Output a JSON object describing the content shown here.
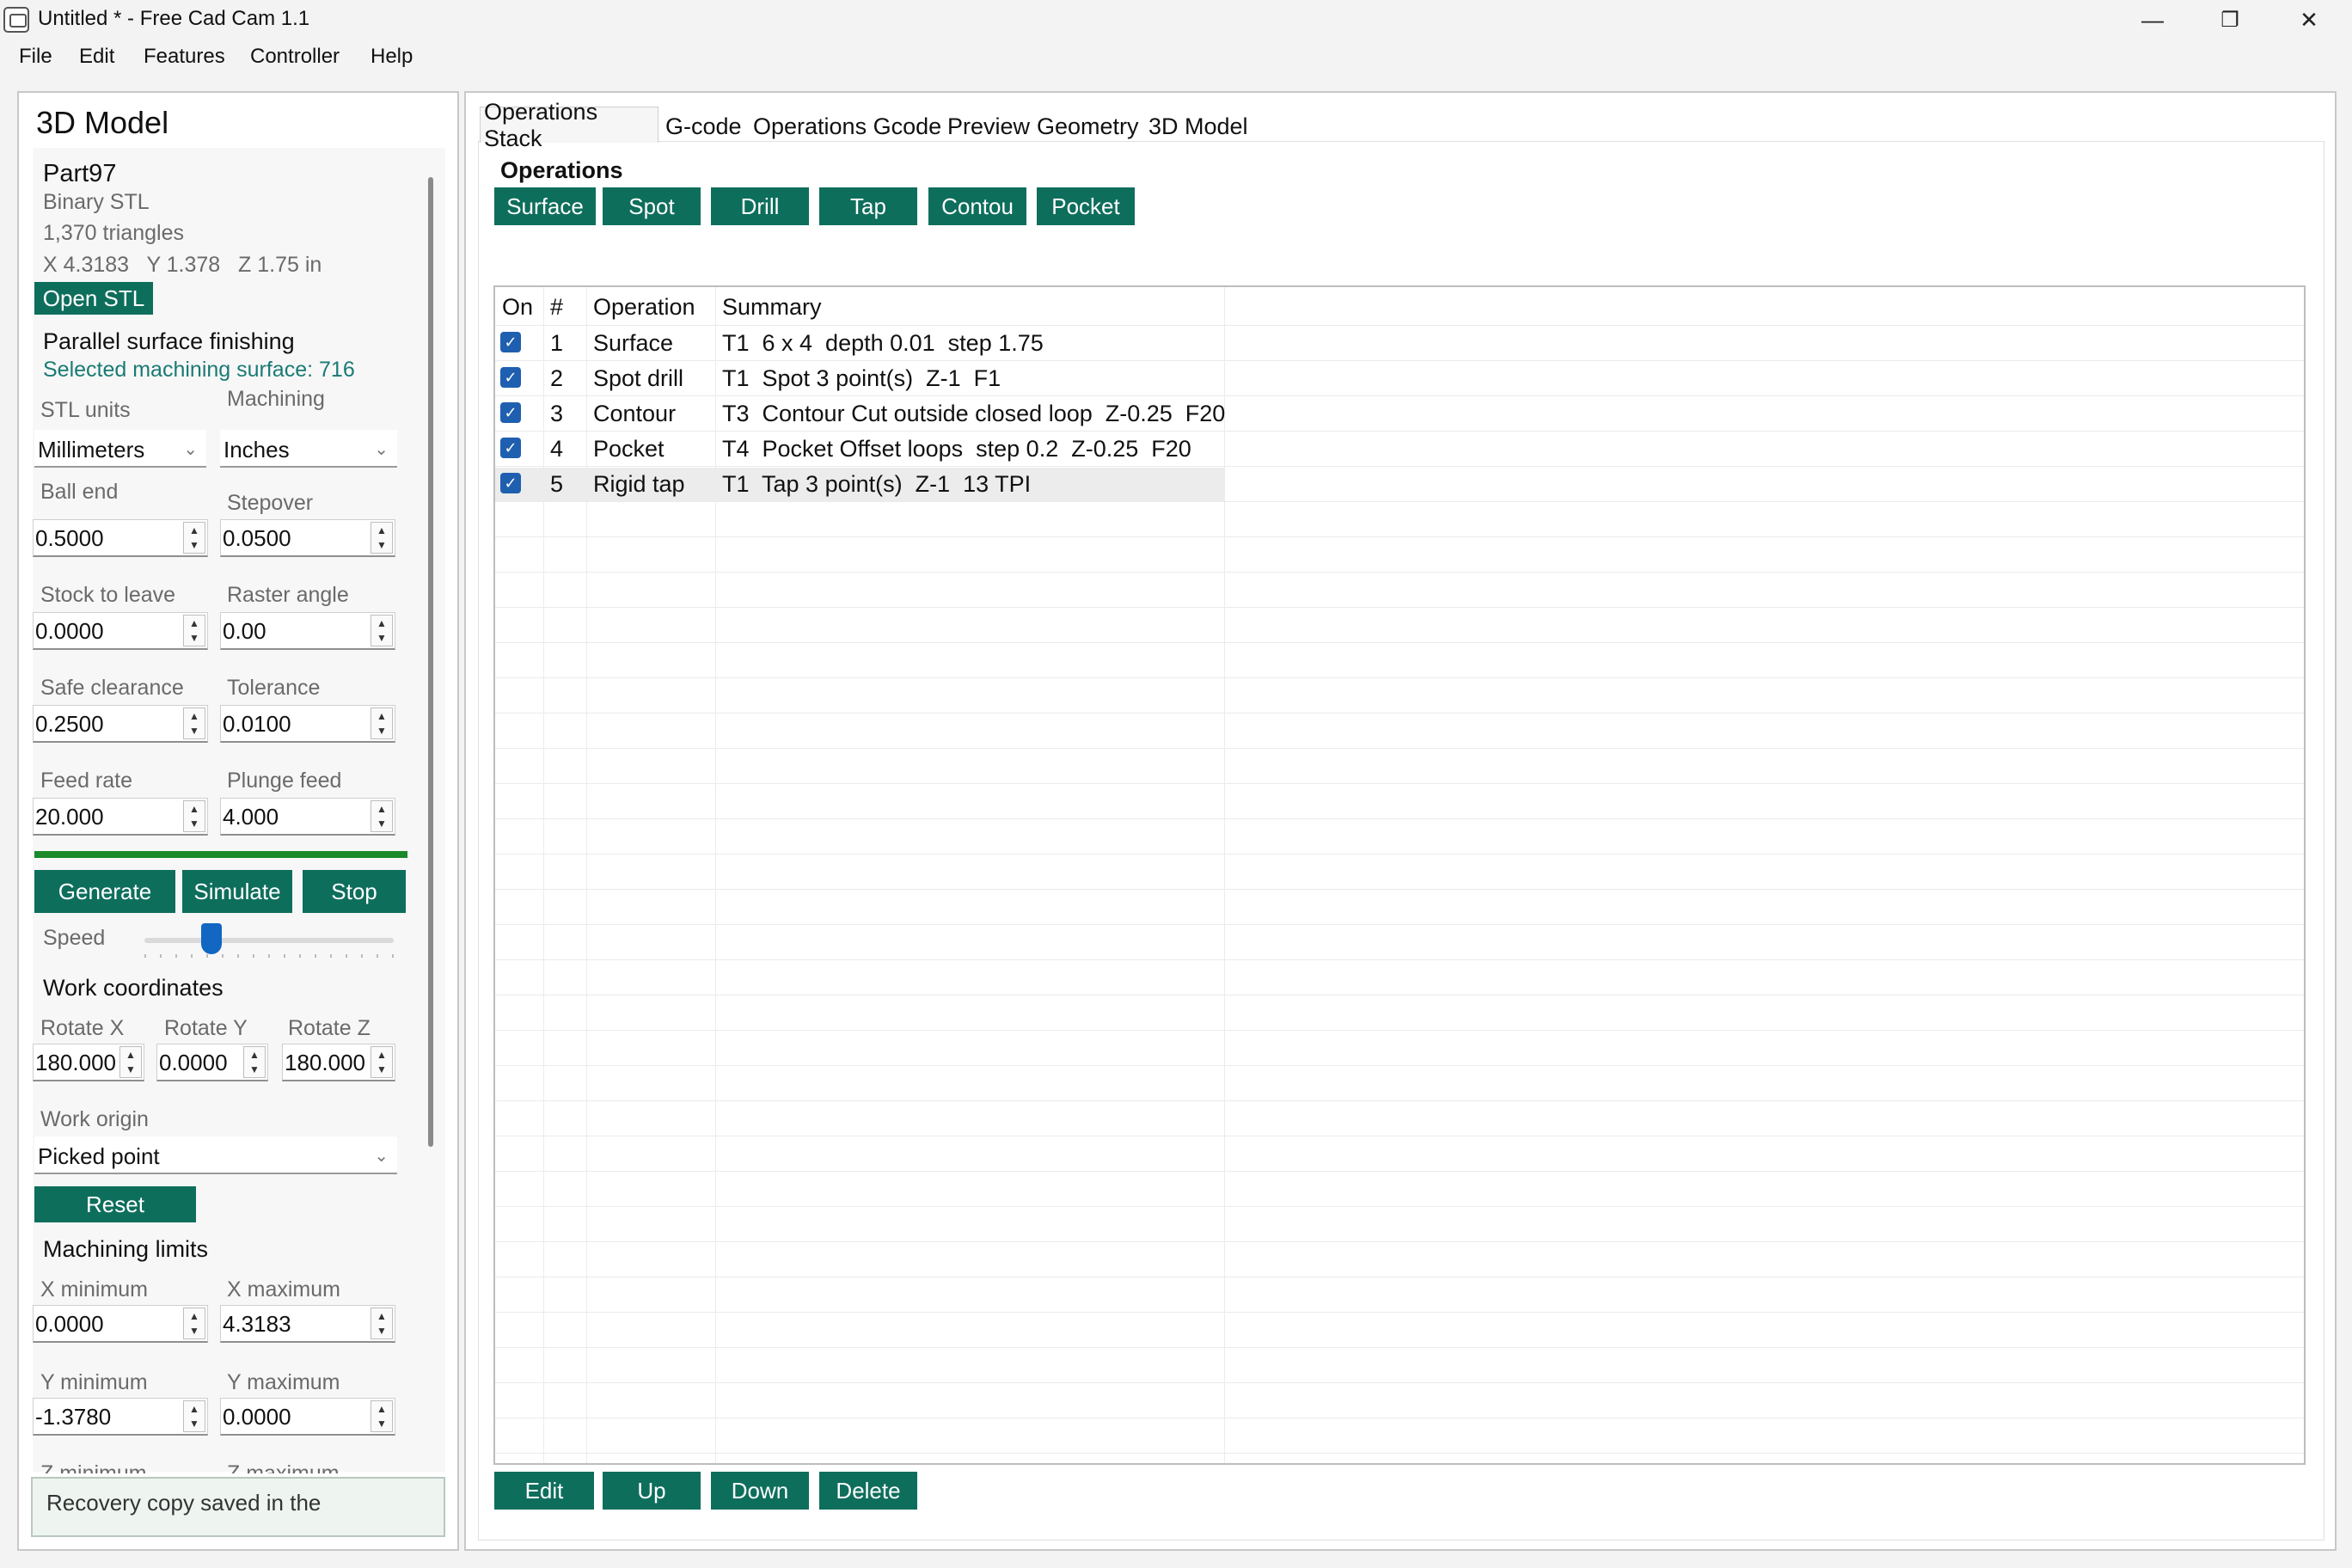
{
  "window": {
    "title": "Untitled * - Free Cad Cam 1.1",
    "min": "—",
    "restore": "❐",
    "close": "✕"
  },
  "menu": [
    "File",
    "Edit",
    "Features",
    "Controller",
    "Help"
  ],
  "left": {
    "title": "3D Model",
    "part_name": "Part97",
    "file_type": "Binary STL",
    "triangles": "1,370 triangles",
    "dims": "X 4.3183   Y 1.378   Z 1.75 in",
    "open_stl": "Open STL",
    "operation_title": "Parallel surface finishing",
    "selected_surface": "Selected machining surface: 716",
    "stl_units_label": "STL units",
    "machining_label": "Machining",
    "stl_units_value": "Millimeters",
    "machining_value": "Inches",
    "ball_end_label": "Ball end",
    "ball_end_value": "0.5000",
    "stepover_label": "Stepover",
    "stepover_value": "0.0500",
    "stock_label": "Stock to leave",
    "stock_value": "0.0000",
    "raster_label": "Raster angle",
    "raster_value": "0.00",
    "safe_label": "Safe clearance",
    "safe_value": "0.2500",
    "tolerance_label": "Tolerance",
    "tolerance_value": "0.0100",
    "feed_label": "Feed rate",
    "feed_value": "20.000",
    "plunge_label": "Plunge feed",
    "plunge_value": "4.000",
    "generate": "Generate",
    "simulate": "Simulate",
    "stop": "Stop",
    "speed_label": "Speed",
    "speed_level": 0.27,
    "work_coords_title": "Work coordinates",
    "rot_x_label": "Rotate X",
    "rot_x_value": "180.000",
    "rot_y_label": "Rotate Y",
    "rot_y_value": "0.0000",
    "rot_z_label": "Rotate Z",
    "rot_z_value": "180.000",
    "work_origin_label": "Work origin",
    "work_origin_value": "Picked point",
    "reset": "Reset",
    "limits_title": "Machining limits",
    "xmin_label": "X minimum",
    "xmin_value": "0.0000",
    "xmax_label": "X maximum",
    "xmax_value": "4.3183",
    "ymin_label": "Y minimum",
    "ymin_value": "-1.3780",
    "ymax_label": "Y maximum",
    "ymax_value": "0.0000",
    "zmin_label": "Z minimum",
    "zmax_label": "Z maximum",
    "status": "Recovery copy saved in the"
  },
  "tabs": [
    "Operations Stack",
    "G-code",
    "Operations Gcode",
    "Preview",
    "Geometry",
    "3D Model"
  ],
  "ops": {
    "heading": "Operations",
    "add_buttons": [
      "Surface",
      "Spot",
      "Drill",
      "Tap",
      "Contou",
      "Pocket"
    ],
    "columns": [
      "On",
      "#",
      "Operation",
      "Summary"
    ],
    "rows": [
      {
        "on": true,
        "num": "1",
        "op": "Surface",
        "summary": "T1  6 x 4  depth 0.01  step 1.75"
      },
      {
        "on": true,
        "num": "2",
        "op": "Spot drill",
        "summary": "T1  Spot 3 point(s)  Z-1  F1"
      },
      {
        "on": true,
        "num": "3",
        "op": "Contour",
        "summary": "T3  Contour Cut outside closed loop  Z-0.25  F20"
      },
      {
        "on": true,
        "num": "4",
        "op": "Pocket",
        "summary": "T4  Pocket Offset loops  step 0.2  Z-0.25  F20"
      },
      {
        "on": true,
        "num": "5",
        "op": "Rigid tap",
        "summary": "T1  Tap 3 point(s)  Z-1  13 TPI"
      }
    ],
    "actions": [
      "Edit",
      "Up",
      "Down",
      "Delete"
    ]
  }
}
